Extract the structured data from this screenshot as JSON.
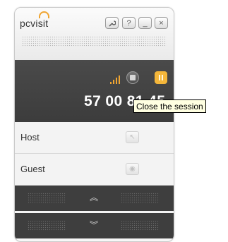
{
  "header": {
    "logo_text": "pcvisit",
    "buttons": {
      "tools_icon": "wrench-icon",
      "help_label": "?",
      "minimize_label": "_",
      "close_label": "×"
    }
  },
  "session": {
    "id_display": "57 00 81 45",
    "signal_icon": "signal-strength-icon",
    "stop_icon": "stop-icon",
    "pause_icon": "pause-icon"
  },
  "rows": [
    {
      "label": "Host",
      "icon": "arrow-up-left-icon",
      "glyph": "↖"
    },
    {
      "label": "Guest",
      "icon": "eye-icon",
      "glyph": "◉"
    }
  ],
  "nav": {
    "up_glyph": "︽",
    "down_glyph": "︾"
  },
  "tooltip": {
    "text": "Close the session"
  },
  "colors": {
    "accent": "#f0a531",
    "dark_panel": "#3e3e3e",
    "tooltip_bg": "#ffffe1"
  }
}
